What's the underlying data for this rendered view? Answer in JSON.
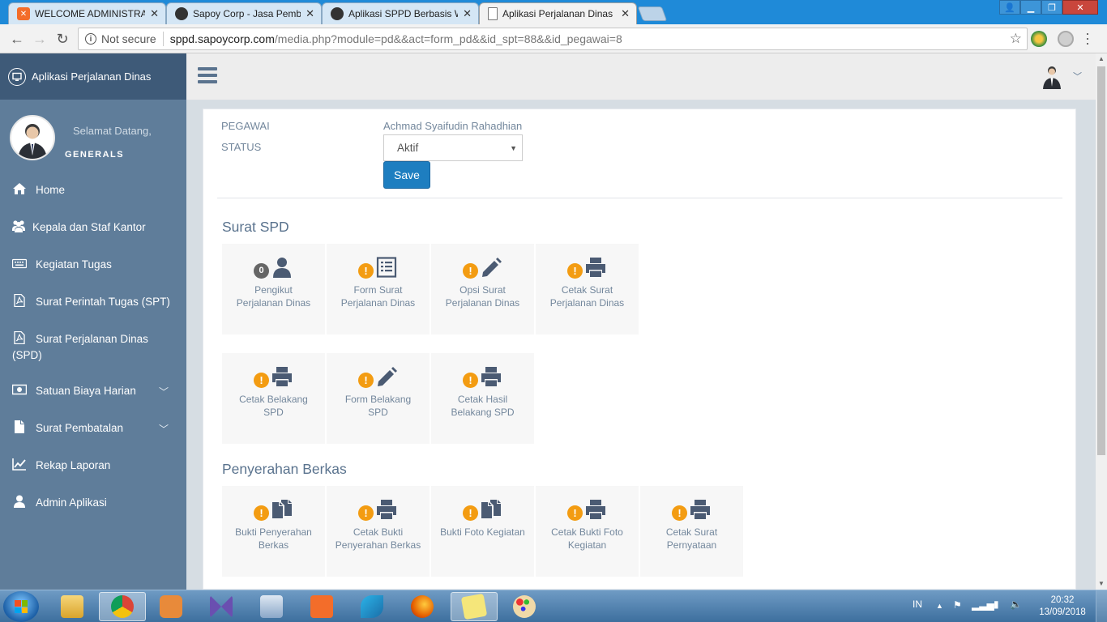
{
  "browser": {
    "tabs": [
      {
        "title": "WELCOME ADMINISTRATOR",
        "favicon": "xampp-icon"
      },
      {
        "title": "Sapoy Corp - Jasa Pembuatan",
        "favicon": "sapoy-icon"
      },
      {
        "title": "Aplikasi SPPD Berbasis Web",
        "favicon": "sapoy-icon"
      },
      {
        "title": "Aplikasi Perjalanan Dinas",
        "favicon": "page-icon",
        "active": true
      }
    ],
    "security": "Not secure",
    "url_host": "sppd.sapoycorp.com",
    "url_path": "/media.php?module=pd&&act=form_pd&&id_spt=88&&id_pegawai=8"
  },
  "sidebar": {
    "brand": "Aplikasi Perjalanan Dinas",
    "welcome": "Selamat Datang,",
    "username": "GENERALS",
    "items": [
      {
        "label": "Home",
        "icon": "home-icon"
      },
      {
        "label": "Kepala dan Staf Kantor",
        "icon": "users-icon"
      },
      {
        "label": "Kegiatan Tugas",
        "icon": "keyboard-icon"
      },
      {
        "label": "Surat Perintah Tugas (SPT)",
        "icon": "file-pdf-icon"
      },
      {
        "label": "Surat Perjalanan Dinas (SPD)",
        "icon": "file-pdf-icon"
      },
      {
        "label": "Satuan Biaya Harian",
        "icon": "money-icon",
        "has_submenu": true
      },
      {
        "label": "Surat Pembatalan",
        "icon": "file-icon",
        "has_submenu": true
      },
      {
        "label": "Rekap Laporan",
        "icon": "line-chart-icon"
      },
      {
        "label": "Admin Aplikasi",
        "icon": "user-icon"
      }
    ]
  },
  "form": {
    "pegawai_label": "PEGAWAI",
    "pegawai_value": "Achmad Syaifudin Rahadhian",
    "status_label": "STATUS",
    "status_value": "Aktif",
    "save_label": "Save"
  },
  "sections": {
    "surat_spd": "Surat SPD",
    "penyerahan": "Penyerahan Berkas"
  },
  "tiles_row1": [
    {
      "label1": "Pengikut",
      "label2": "Perjalanan Dinas",
      "badge": "0",
      "icon": "user-icon"
    },
    {
      "label1": "Form Surat",
      "label2": "Perjalanan Dinas",
      "badge": "!",
      "icon": "list-icon"
    },
    {
      "label1": "Opsi Surat",
      "label2": "Perjalanan Dinas",
      "badge": "!",
      "icon": "pencil-icon"
    },
    {
      "label1": "Cetak Surat",
      "label2": "Perjalanan Dinas",
      "badge": "!",
      "icon": "printer-icon"
    }
  ],
  "tiles_row2": [
    {
      "label1": "Cetak Belakang",
      "label2": "SPD",
      "badge": "!",
      "icon": "printer-icon"
    },
    {
      "label1": "Form Belakang",
      "label2": "SPD",
      "badge": "!",
      "icon": "pencil-icon"
    },
    {
      "label1": "Cetak Hasil",
      "label2": "Belakang SPD",
      "badge": "!",
      "icon": "printer-icon"
    }
  ],
  "tiles_row3": [
    {
      "label1": "Bukti Penyerahan",
      "label2": "Berkas",
      "badge": "!",
      "icon": "copy-icon"
    },
    {
      "label1": "Cetak Bukti",
      "label2": "Penyerahan Berkas",
      "badge": "!",
      "icon": "printer-icon"
    },
    {
      "label1": "Bukti Foto Kegiatan",
      "label2": "",
      "badge": "!",
      "icon": "copy-icon"
    },
    {
      "label1": "Cetak Bukti Foto",
      "label2": "Kegiatan",
      "badge": "!",
      "icon": "printer-icon"
    },
    {
      "label1": "Cetak Surat",
      "label2": "Pernyataan",
      "badge": "!",
      "icon": "printer-icon"
    }
  ],
  "taskbar": {
    "lang": "IN",
    "time": "20:32",
    "date": "13/09/2018"
  },
  "colors": {
    "sidebar": "#5f7d9a",
    "brand": "#3e5a78",
    "accent": "#1e7ec0",
    "badge": "#f39c12"
  }
}
